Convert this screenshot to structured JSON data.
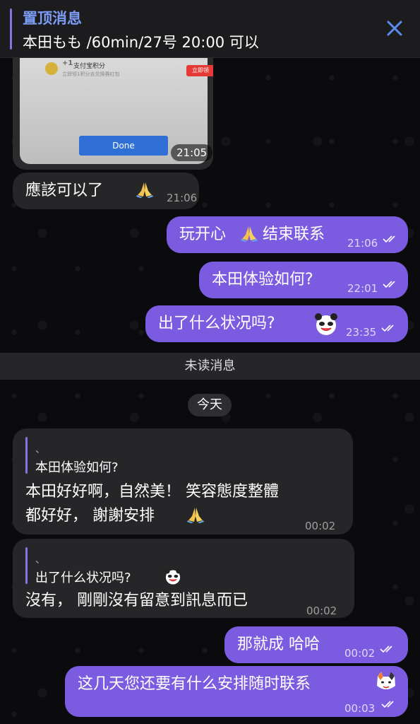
{
  "pinned": {
    "title": "置顶消息",
    "text": "本田もも /60min/27号 20:00 可以"
  },
  "image_message": {
    "plus": "+1",
    "points_label": "支付宝积分",
    "points_sub": "立即领1积分去兑换赛红包",
    "red_button": "立即领",
    "done_label": "Done",
    "time": "21:05"
  },
  "messages": [
    {
      "dir": "in",
      "text": "應該可以了",
      "time": "21:06"
    },
    {
      "dir": "out",
      "text_a": "玩开心",
      "text_b": "结束联系",
      "time": "21:06"
    },
    {
      "dir": "out",
      "text": "本田体验如何?",
      "time": "22:01"
    },
    {
      "dir": "out",
      "text": "出了什么状况吗?",
      "time": "23:35"
    }
  ],
  "unread_label": "未读消息",
  "date_label": "今天",
  "replies": [
    {
      "quote_mark": "、",
      "quote": "本田体验如何?",
      "line1": "本田好好啊，自然美！ 笑容態度整體",
      "line2": "都好好， 謝謝安排",
      "time": "00:02"
    },
    {
      "quote_mark": "、",
      "quote": "出了什么状况吗?",
      "line1": "沒有， 剛剛沒有留意到訊息而已",
      "time": "00:02"
    }
  ],
  "out_messages_2": [
    {
      "text": "那就成 哈哈",
      "time": "00:02"
    },
    {
      "text": "这几天您还要有什么安排随时联系",
      "time": "00:03"
    }
  ],
  "colors": {
    "accent": "#7b5ce0",
    "incoming": "#262629",
    "pinned_title": "#7c9cf5"
  }
}
